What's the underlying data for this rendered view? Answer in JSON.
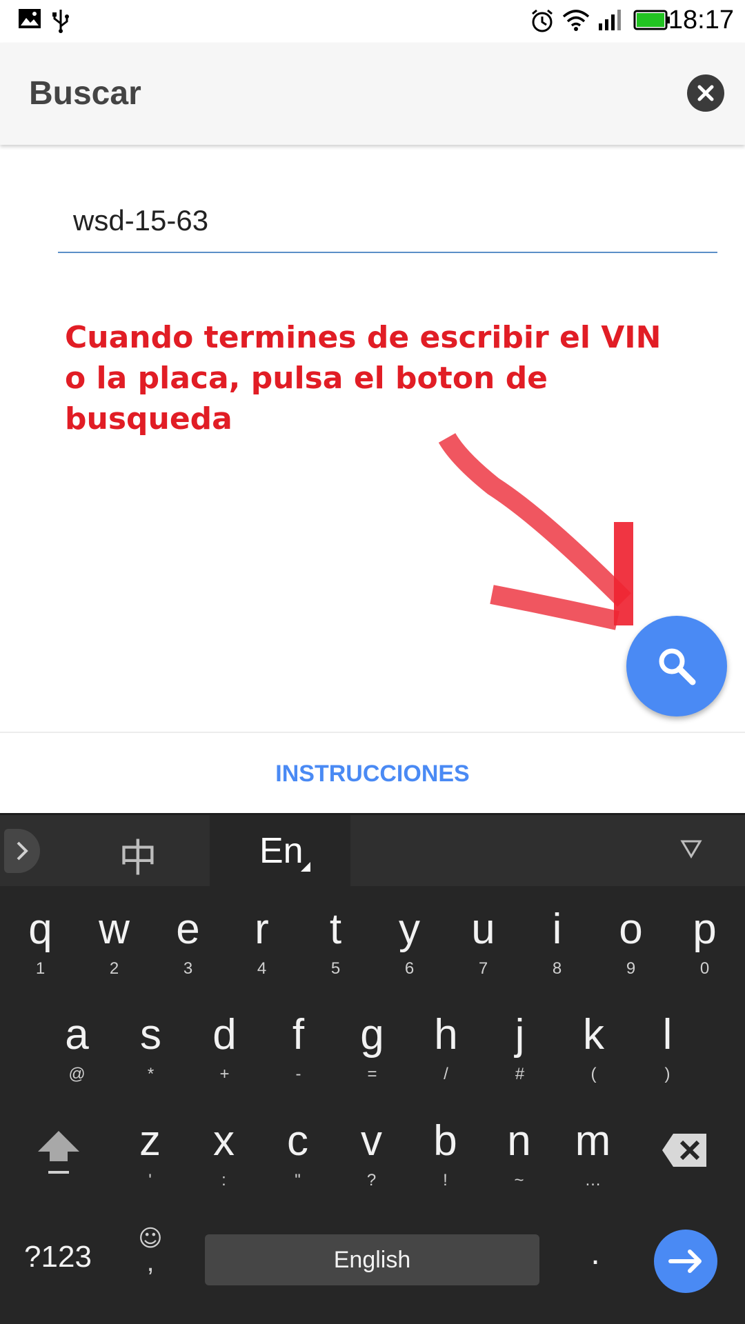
{
  "status_bar": {
    "time": "18:17",
    "icons": [
      "gallery-icon",
      "usb-icon",
      "alarm-icon",
      "wifi-icon",
      "signal-icon",
      "battery-icon"
    ],
    "battery_color": "#22c322"
  },
  "header": {
    "title": "Buscar",
    "close_icon": "close-circle-icon"
  },
  "search": {
    "value": "wsd-15-63",
    "underline_color": "#5b8fc7"
  },
  "annotation": {
    "text": "Cuando termines de escribir el VIN o la placa, pulsa el boton de busqueda",
    "color": "#e11d25"
  },
  "fab": {
    "icon": "search-icon",
    "color": "#4a8af4"
  },
  "instructions": {
    "label": "INSTRUCCIONES",
    "color": "#4a8af4"
  },
  "keyboard": {
    "toolbar": {
      "lang_zh": "中",
      "lang_en": "En"
    },
    "rows": [
      [
        {
          "main": "q",
          "sub": "1"
        },
        {
          "main": "w",
          "sub": "2"
        },
        {
          "main": "e",
          "sub": "3"
        },
        {
          "main": "r",
          "sub": "4"
        },
        {
          "main": "t",
          "sub": "5"
        },
        {
          "main": "y",
          "sub": "6"
        },
        {
          "main": "u",
          "sub": "7"
        },
        {
          "main": "i",
          "sub": "8"
        },
        {
          "main": "o",
          "sub": "9"
        },
        {
          "main": "p",
          "sub": "0"
        }
      ],
      [
        {
          "main": "a",
          "sub": "@"
        },
        {
          "main": "s",
          "sub": "*"
        },
        {
          "main": "d",
          "sub": "+"
        },
        {
          "main": "f",
          "sub": "-"
        },
        {
          "main": "g",
          "sub": "="
        },
        {
          "main": "h",
          "sub": "/"
        },
        {
          "main": "j",
          "sub": "#"
        },
        {
          "main": "k",
          "sub": "("
        },
        {
          "main": "l",
          "sub": ")"
        }
      ],
      [
        {
          "main": "z",
          "sub": "'"
        },
        {
          "main": "x",
          "sub": ":"
        },
        {
          "main": "c",
          "sub": "\""
        },
        {
          "main": "v",
          "sub": "?"
        },
        {
          "main": "b",
          "sub": "!"
        },
        {
          "main": "n",
          "sub": "~"
        },
        {
          "main": "m",
          "sub": "…"
        }
      ]
    ],
    "symbols_label": "?123",
    "emoji_comma": ",",
    "space_label": "English",
    "period_label": ".",
    "enter_color": "#4a8af4"
  }
}
